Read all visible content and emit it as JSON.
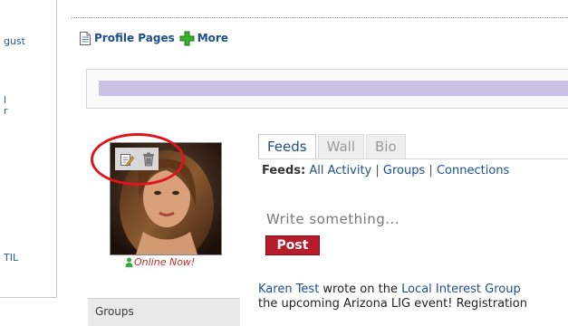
{
  "left_sidebar": {
    "items": [
      "gust",
      "l",
      "r",
      "TIL"
    ]
  },
  "profile_bar": {
    "profile_pages_label": "Profile Pages",
    "more_label": "More"
  },
  "profile": {
    "online_status": "Online Now!"
  },
  "groups": {
    "label": "Groups"
  },
  "tabs": [
    {
      "label": "Feeds",
      "active": true
    },
    {
      "label": "Wall",
      "active": false
    },
    {
      "label": "Bio",
      "active": false
    }
  ],
  "feed_filter": {
    "prefix": "Feeds:",
    "options": [
      "All Activity",
      "Groups",
      "Connections"
    ],
    "separator": "|"
  },
  "composer": {
    "placeholder": "Write something...",
    "post_label": "Post"
  },
  "activity": {
    "author": "Karen Test",
    "verb": " wrote on the ",
    "target": "Local Interest Group",
    "line2": "the upcoming Arizona LIG event! Registration"
  },
  "colors": {
    "link": "#1c4f8f",
    "post_button": "#b71c2b",
    "banner": "#c9c2e6",
    "highlight_circle": "#e0141e",
    "online_text": "#c62828"
  },
  "icons": [
    "page-icon",
    "plus-icon",
    "edit-icon",
    "trash-icon",
    "user-online-icon"
  ]
}
